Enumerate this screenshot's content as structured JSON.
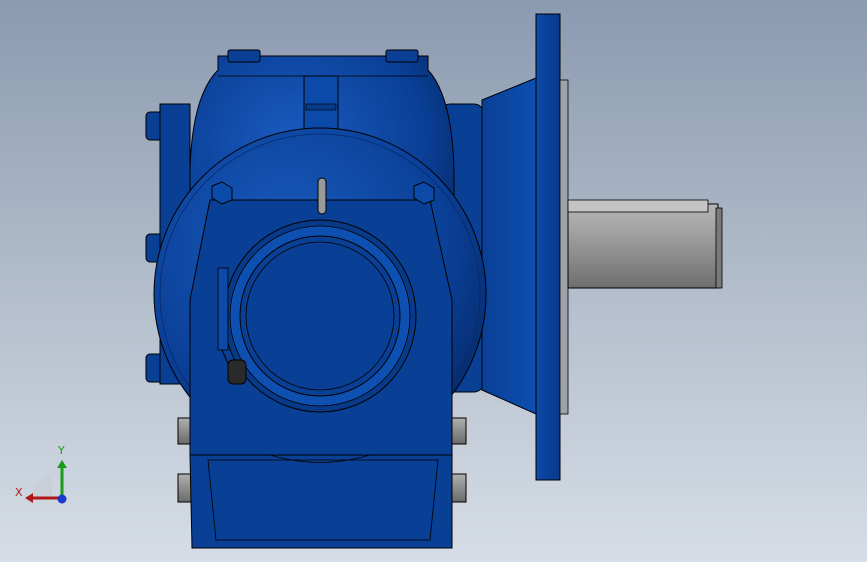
{
  "viewport": {
    "background_top": "#8a9ab0",
    "background_bottom": "#d6dde6"
  },
  "model": {
    "body_color": "#0a3f96",
    "body_dark": "#062a6a",
    "body_light": "#1a5cc0",
    "shaft_color": "#8c8c8c",
    "bolt_color": "#2a2a2a",
    "outline_color": "#000000"
  },
  "triad": {
    "x_label": "X",
    "y_label": "Y",
    "x_color": "#b01818",
    "y_color": "#1a9a1a",
    "z_color": "#1a3ad0"
  }
}
